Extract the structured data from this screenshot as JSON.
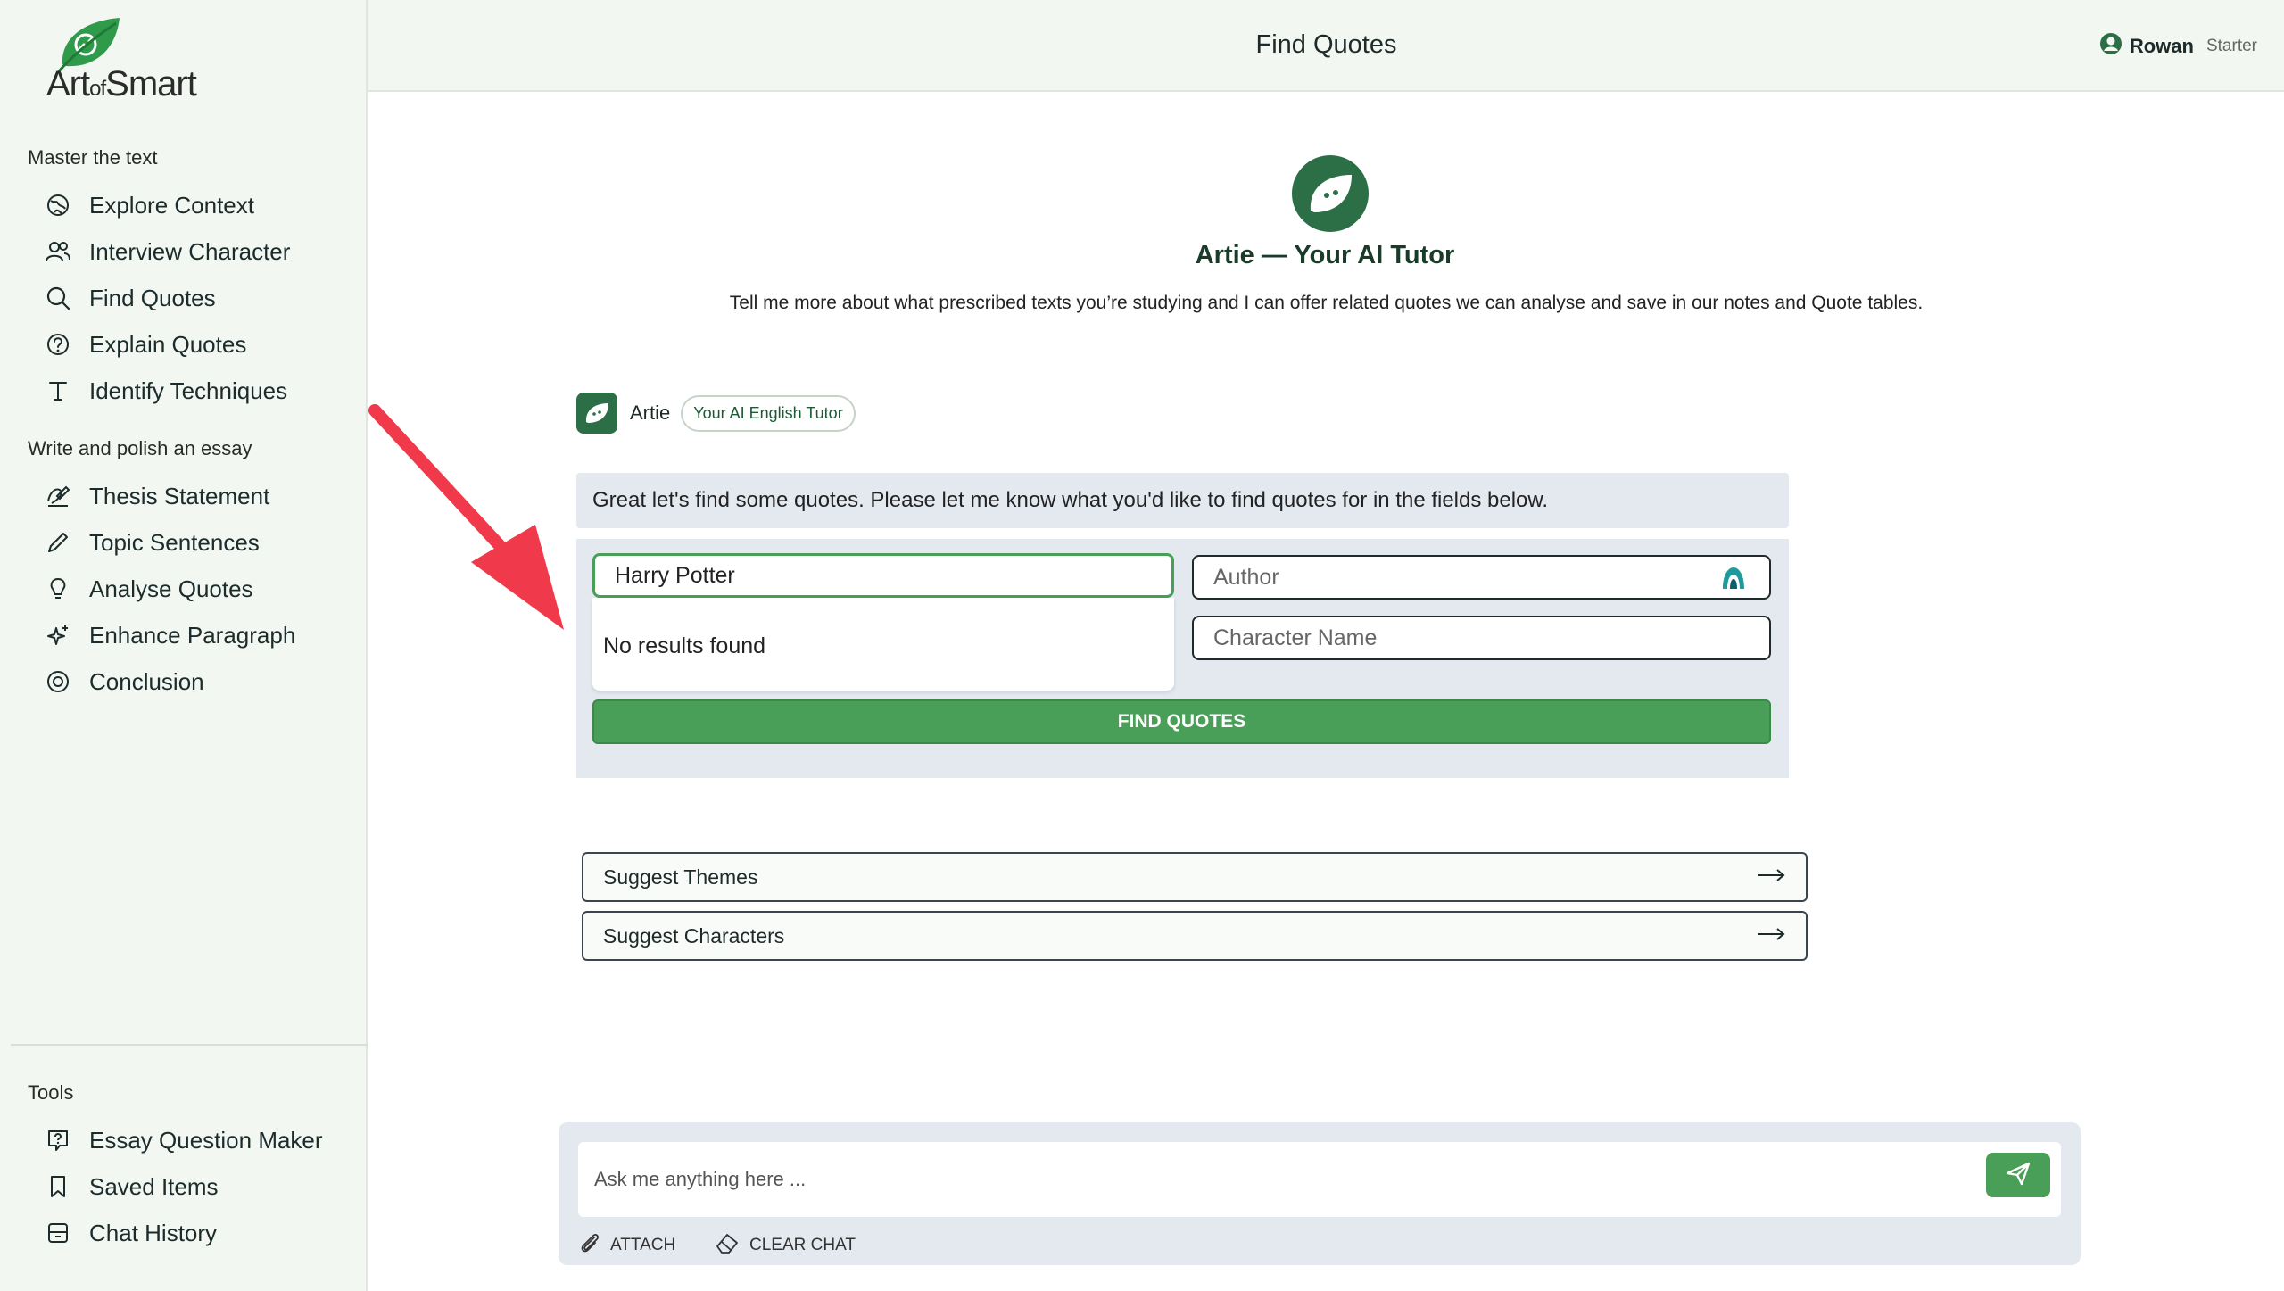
{
  "brand": {
    "name_part1": "Art",
    "name_part2": "of",
    "name_part3": "Smart"
  },
  "header": {
    "title": "Find Quotes",
    "user_name": "Rowan",
    "user_plan": "Starter"
  },
  "sidebar": {
    "section1_title": "Master the text",
    "section1_items": [
      {
        "label": "Explore Context",
        "icon": "globe-icon"
      },
      {
        "label": "Interview Character",
        "icon": "users-icon"
      },
      {
        "label": "Find Quotes",
        "icon": "search-icon"
      },
      {
        "label": "Explain Quotes",
        "icon": "help-circle-icon"
      },
      {
        "label": "Identify Techniques",
        "icon": "type-icon"
      }
    ],
    "section2_title": "Write and polish an essay",
    "section2_items": [
      {
        "label": "Thesis Statement",
        "icon": "signature-icon"
      },
      {
        "label": "Topic Sentences",
        "icon": "pencil-icon"
      },
      {
        "label": "Analyse Quotes",
        "icon": "lightbulb-icon"
      },
      {
        "label": "Enhance Paragraph",
        "icon": "sparkles-icon"
      },
      {
        "label": "Conclusion",
        "icon": "target-icon"
      }
    ],
    "tools_title": "Tools",
    "tools_items": [
      {
        "label": "Essay Question Maker",
        "icon": "question-square-icon"
      },
      {
        "label": "Saved Items",
        "icon": "bookmark-icon"
      },
      {
        "label": "Chat History",
        "icon": "archive-icon"
      }
    ]
  },
  "hero": {
    "title": "Artie — Your AI Tutor",
    "subtitle": "Tell me more about what prescribed texts you’re studying and I can offer related quotes we can analyse and save in our notes and Quote tables."
  },
  "chat": {
    "bot_name": "Artie",
    "bot_badge": "Your AI English Tutor",
    "message": "Great let's find some quotes. Please let me know what you'd like to find quotes for in the fields below."
  },
  "form": {
    "text_value": "Harry Potter",
    "dropdown_text": "No results found",
    "author_placeholder": "Author",
    "character_placeholder": "Character Name",
    "submit_label": "FIND QUOTES"
  },
  "suggestions": [
    {
      "label": "Suggest Themes"
    },
    {
      "label": "Suggest Characters"
    }
  ],
  "composer": {
    "placeholder": "Ask me anything here ...",
    "attach_label": "ATTACH",
    "clear_label": "CLEAR CHAT"
  },
  "colors": {
    "accent": "#4a9f58",
    "brand_dark": "#2c6e45",
    "panel": "#e4e9f0",
    "annotation": "#f03a4b"
  }
}
